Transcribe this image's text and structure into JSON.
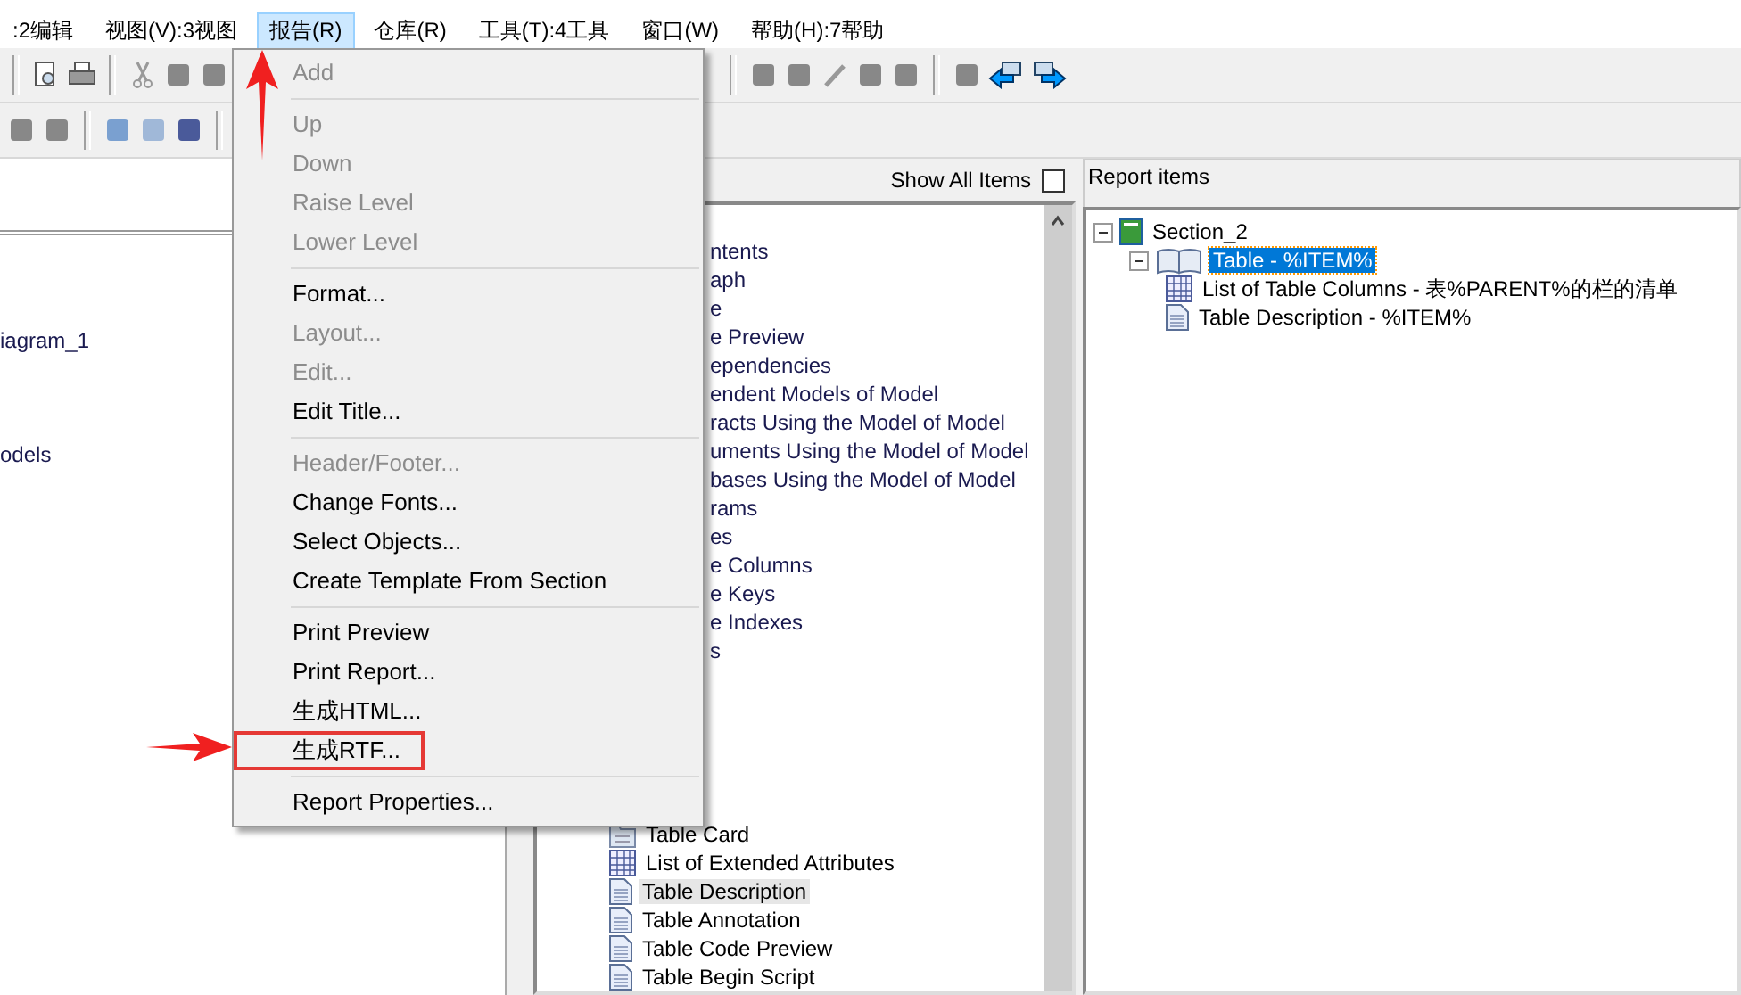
{
  "menu_bar": [
    {
      "label": ":2编辑",
      "selected": false
    },
    {
      "label": "视图(V):3视图",
      "selected": false
    },
    {
      "label": "报告(R)",
      "selected": true
    },
    {
      "label": "仓库(R)",
      "selected": false
    },
    {
      "label": "工具(T):4工具",
      "selected": false
    },
    {
      "label": "窗口(W)",
      "selected": false
    },
    {
      "label": "帮助(H):7帮助",
      "selected": false
    }
  ],
  "report_menu": [
    [
      {
        "label": "Add",
        "disabled": true,
        "highlighted": false
      }
    ],
    [
      {
        "label": "Up",
        "disabled": true,
        "highlighted": false
      },
      {
        "label": "Down",
        "disabled": true,
        "highlighted": false
      },
      {
        "label": "Raise Level",
        "disabled": true,
        "highlighted": false
      },
      {
        "label": "Lower Level",
        "disabled": true,
        "highlighted": false
      }
    ],
    [
      {
        "label": "Format...",
        "disabled": false,
        "highlighted": false
      },
      {
        "label": "Layout...",
        "disabled": true,
        "highlighted": false
      },
      {
        "label": "Edit...",
        "disabled": true,
        "highlighted": false
      },
      {
        "label": "Edit Title...",
        "disabled": false,
        "highlighted": false
      }
    ],
    [
      {
        "label": "Header/Footer...",
        "disabled": true,
        "highlighted": false
      },
      {
        "label": "Change Fonts...",
        "disabled": false,
        "highlighted": false
      },
      {
        "label": "Select Objects...",
        "disabled": false,
        "highlighted": false
      },
      {
        "label": "Create Template From Section",
        "disabled": false,
        "highlighted": false
      }
    ],
    [
      {
        "label": "Print Preview",
        "disabled": false,
        "highlighted": false
      },
      {
        "label": "Print Report...",
        "disabled": false,
        "highlighted": false
      },
      {
        "label": "生成HTML...",
        "disabled": false,
        "highlighted": false
      },
      {
        "label": "生成RTF...",
        "disabled": false,
        "highlighted": true
      }
    ],
    [
      {
        "label": "Report Properties...",
        "disabled": false,
        "highlighted": false
      }
    ]
  ],
  "left_pane": {
    "items": [
      "iagram_1",
      "odels"
    ]
  },
  "available_items": {
    "show_all_items": {
      "label": "Show All Items",
      "checked": false
    },
    "partial_rows": [
      "ntents",
      "aph",
      "e",
      "e Preview",
      "ependencies",
      "endent Models of Model",
      "racts Using the Model of Model",
      "uments Using the Model of Model",
      "bases Using the Model of Model",
      "rams",
      "es",
      "e Columns",
      "e Keys",
      "e Indexes",
      "s"
    ],
    "rows": [
      {
        "label": "Table Card",
        "kind": "card",
        "selected": false
      },
      {
        "label": "List of Extended Attributes",
        "kind": "list",
        "selected": false
      },
      {
        "label": "Table Description",
        "kind": "doc",
        "selected": true
      },
      {
        "label": "Table Annotation",
        "kind": "doc",
        "selected": false
      },
      {
        "label": "Table Code Preview",
        "kind": "doc",
        "selected": false
      },
      {
        "label": "Table Begin Script",
        "kind": "doc",
        "selected": false
      }
    ]
  },
  "report_items": {
    "title": "Report items",
    "tree": [
      {
        "label": "Section_2",
        "kind": "section",
        "selected": false,
        "expanded": true,
        "children": [
          {
            "label": "Table - %ITEM%",
            "kind": "book",
            "selected": true,
            "expanded": true,
            "children": [
              {
                "label": "List of Table Columns - 表%PARENT%的栏的清单",
                "kind": "list",
                "selected": false
              },
              {
                "label": "Table Description - %ITEM%",
                "kind": "doc",
                "selected": false
              }
            ]
          }
        ]
      }
    ]
  }
}
